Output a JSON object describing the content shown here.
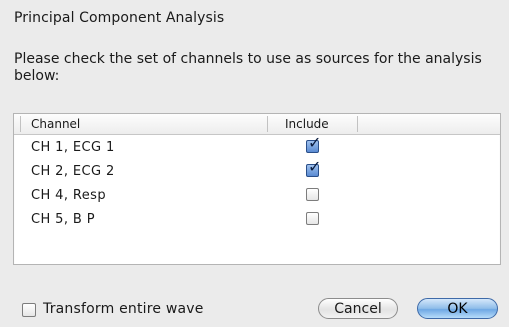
{
  "dialog": {
    "title": "Principal Component Analysis",
    "instructions": "Please check the set of channels to use as sources for the analysis below:"
  },
  "table": {
    "headers": {
      "channel": "Channel",
      "include": "Include"
    },
    "rows": [
      {
        "channel": "CH 1, ECG 1",
        "include": true
      },
      {
        "channel": "CH 2, ECG 2",
        "include": true
      },
      {
        "channel": "CH 4, Resp",
        "include": false
      },
      {
        "channel": "CH 5, B P",
        "include": false
      }
    ]
  },
  "options": {
    "transform_label": "Transform entire wave",
    "transform_checked": false
  },
  "buttons": {
    "cancel": "Cancel",
    "ok": "OK"
  }
}
